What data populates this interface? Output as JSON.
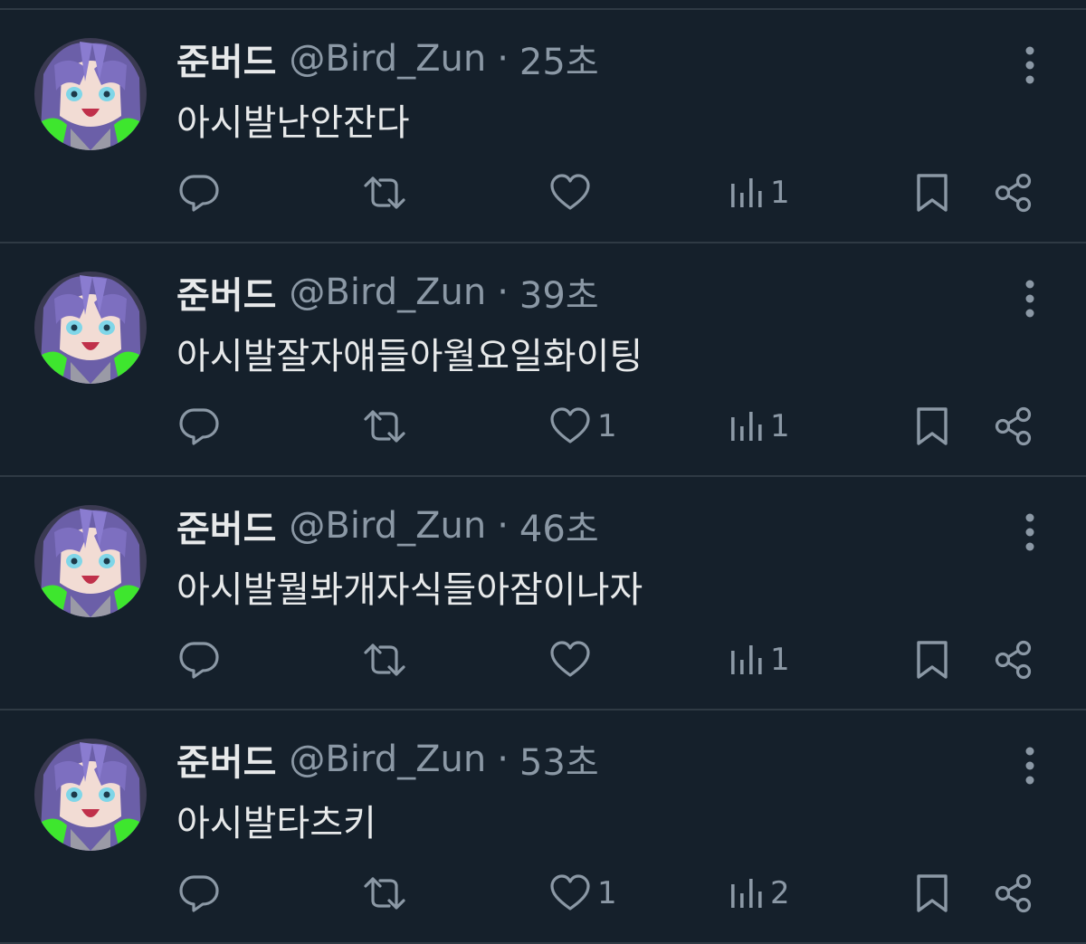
{
  "colors": {
    "background": "#15202b",
    "divider": "#2f3a44",
    "text_primary": "#e7e9ea",
    "text_secondary": "#8b98a5"
  },
  "icons": {
    "reply": "speech-bubble-icon",
    "retweet": "retweet-arrows-icon",
    "like": "heart-icon",
    "views": "bar-chart-icon",
    "bookmark": "bookmark-icon",
    "share": "share-icon",
    "more": "vertical-dots-icon"
  },
  "tweets": [
    {
      "name": "준버드",
      "handle": "@Bird_Zun",
      "separator": "·",
      "time": "25초",
      "text": "아시발난안잔다",
      "replies": "",
      "retweets": "",
      "likes": "",
      "views": "1"
    },
    {
      "name": "준버드",
      "handle": "@Bird_Zun",
      "separator": "·",
      "time": "39초",
      "text": "아시발잘자얘들아월요일화이팅",
      "replies": "",
      "retweets": "",
      "likes": "1",
      "views": "1"
    },
    {
      "name": "준버드",
      "handle": "@Bird_Zun",
      "separator": "·",
      "time": "46초",
      "text": "아시발뭘봐개자식들아잠이나자",
      "replies": "",
      "retweets": "",
      "likes": "",
      "views": "1"
    },
    {
      "name": "준버드",
      "handle": "@Bird_Zun",
      "separator": "·",
      "time": "53초",
      "text": "아시발타츠키",
      "replies": "",
      "retweets": "",
      "likes": "1",
      "views": "2"
    }
  ]
}
